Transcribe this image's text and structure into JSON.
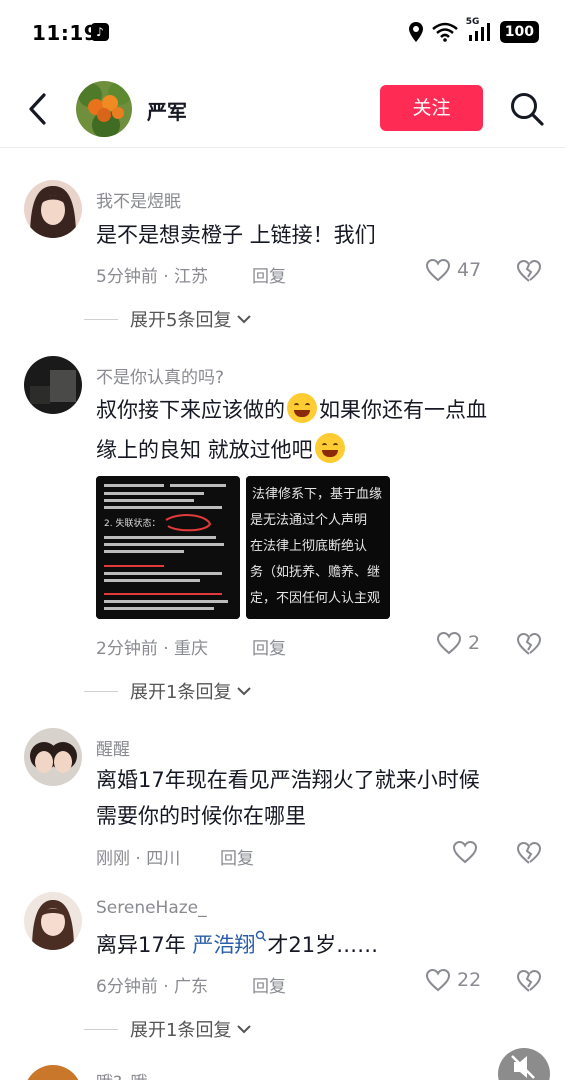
{
  "status_bar": {
    "time": "11:19",
    "network": "5G",
    "battery": "100"
  },
  "header": {
    "name": "严军",
    "follow_label": "关注"
  },
  "comments": [
    {
      "username": "我不是煜眠",
      "text": "是不是想卖橙子 上链接！我们",
      "time_location": "5分钟前 · 江苏",
      "reply_label": "回复",
      "likes": "47",
      "expand_label": "展开5条回复"
    },
    {
      "username": "不是你认真的吗?",
      "text_part1": "叔你接下来应该做的",
      "text_part2": "如果你还有一点血",
      "text_part3": "缘上的良知 就放过他吧",
      "time_location": "2分钟前 · 重庆",
      "reply_label": "回复",
      "likes": "2",
      "expand_label": "展开1条回复",
      "image1_lines": [
        "2. 失联状态：",
        "1. 法律关系",
        "3. 失联后果"
      ],
      "image2_lines": [
        "法律修系下，基于血缘",
        "是无法通过个人声明",
        "在法律上彻底断绝认",
        "务（如抚养、赡养、继",
        "定，不因任何人认主观"
      ]
    },
    {
      "username": "醒醒",
      "text_line1": "离婚17年现在看见严浩翔火了就来小时候",
      "text_line2": "需要你的时候你在哪里",
      "time_location": "刚刚 · 四川",
      "reply_label": "回复"
    },
    {
      "username": "SereneHaze_",
      "text_before": "离异17年 ",
      "mention": "严浩翔",
      "text_after": "才21岁……",
      "time_location": "6分钟前 · 广东",
      "reply_label": "回复",
      "likes": "22",
      "expand_label": "展开1条回复"
    },
    {
      "username": "哦?_哦"
    }
  ],
  "icons": {
    "accent": "#fe2c55"
  }
}
